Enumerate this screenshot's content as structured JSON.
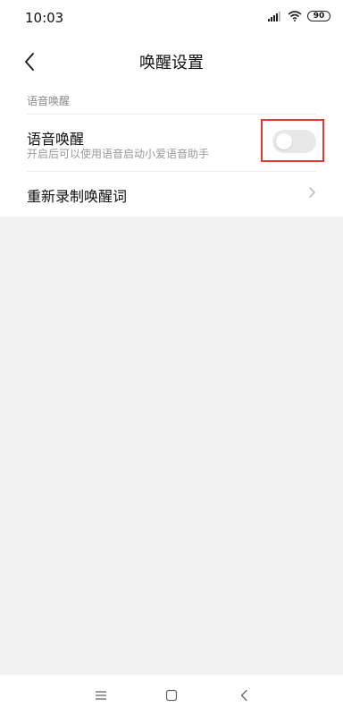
{
  "status_bar": {
    "time": "10:03",
    "battery": "90"
  },
  "header": {
    "title": "唤醒设置",
    "back_icon": "chevron-left-icon"
  },
  "section": {
    "header": "语音唤醒"
  },
  "settings": {
    "voice_wake": {
      "title": "语音唤醒",
      "subtitle": "开启后可以使用语音启动小爱语音助手",
      "enabled": false,
      "highlight_color": "#e53935"
    },
    "rerecord": {
      "title": "重新录制唤醒词",
      "icon": "chevron-right-icon"
    }
  },
  "bottom_nav": {
    "icons": [
      "menu-icon",
      "home-icon",
      "back-icon"
    ]
  }
}
